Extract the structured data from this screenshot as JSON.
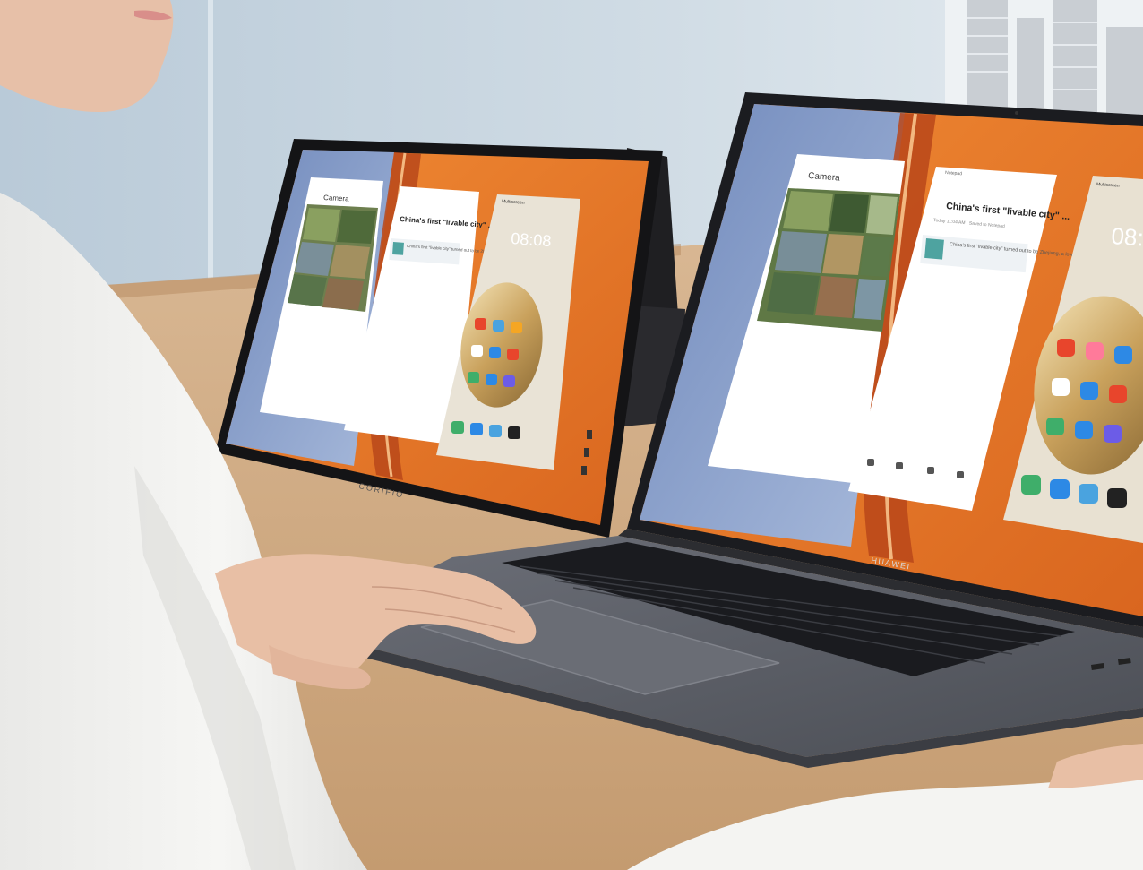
{
  "scene": {
    "description_type": "product photo",
    "colors": {
      "wall": "#c9d6e0",
      "window": "#e8eef2",
      "desk": "#cda880",
      "sleeve": "#f2f2f0",
      "skin": "#e9c3ad",
      "laptop_body": "#5e6168",
      "keyboard": "#1c1d21",
      "monitor_frame": "#1a1a1c",
      "wallpaper_orange": "#e8782a",
      "wallpaper_blue": "#7f97c4",
      "app_card": "#ffffff"
    }
  },
  "laptop": {
    "brand": "HUAWEI",
    "camera_window": {
      "title": "Camera"
    },
    "news_window": {
      "header": "Notepad",
      "headline": "China's first \"livable city\" ...",
      "meta": "Today 11:04 AM  ·  Saved to Notepad",
      "snippet": "China's first \"livable city\" turned out to be Zhejiang, a low-key"
    },
    "phone_window": {
      "header": "Multiscreen",
      "clock": "08:"
    }
  },
  "monitor": {
    "brand": "CORIFIO",
    "camera_window": {
      "title": "Camera"
    },
    "news_window": {
      "headline": "China's first \"livable city\" ...",
      "snippet": "China's first \"livable city\" turned out to be Zhejiang"
    },
    "phone_window": {
      "header": "Multiscreen",
      "clock": "08:08"
    }
  }
}
